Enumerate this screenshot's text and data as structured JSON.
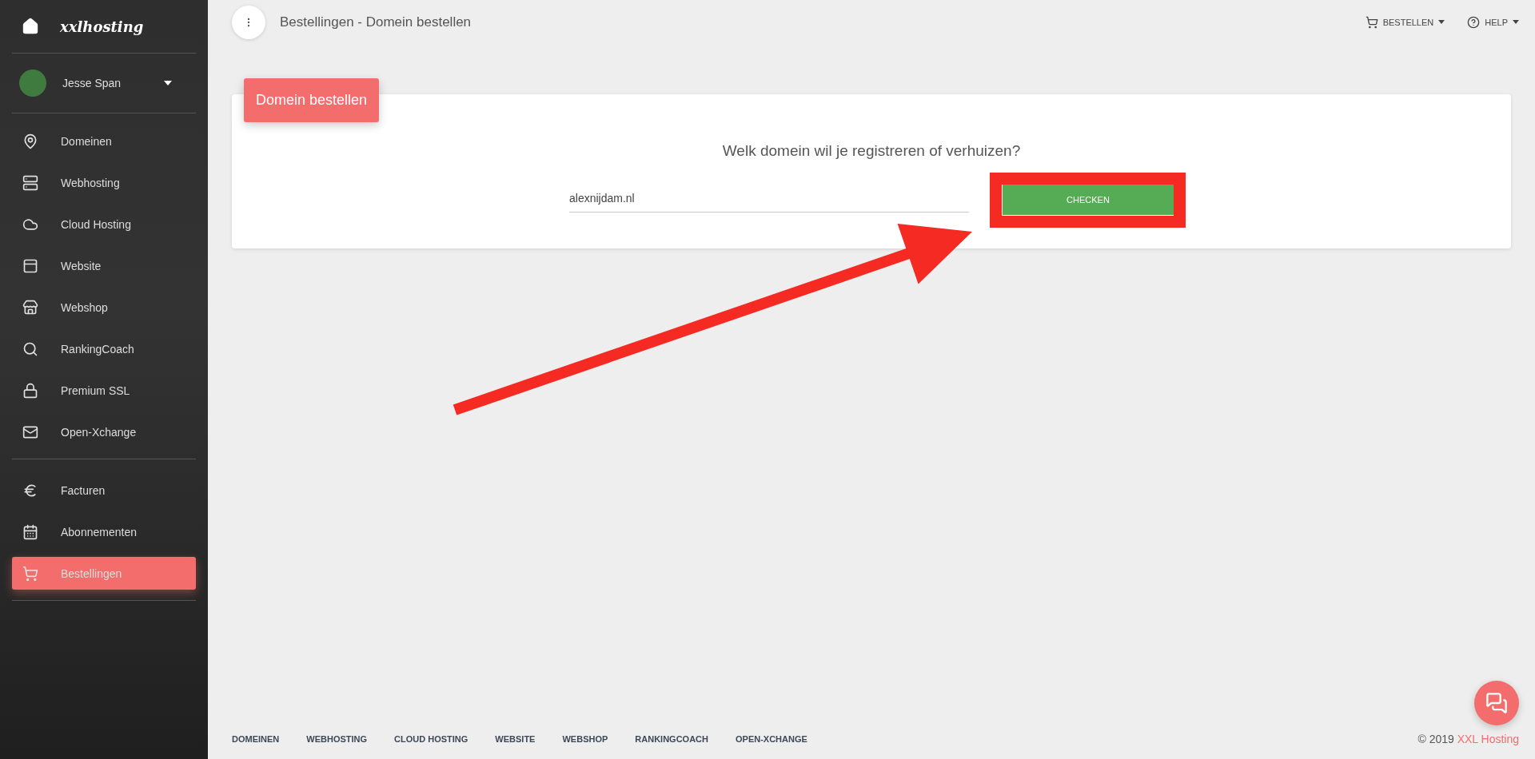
{
  "sidebar": {
    "brand": "xxlhosting",
    "user": {
      "name": "Jesse Span"
    },
    "sections": [
      [
        {
          "label": "Domeinen",
          "selected": false
        },
        {
          "label": "Webhosting",
          "selected": false
        },
        {
          "label": "Cloud Hosting",
          "selected": false
        },
        {
          "label": "Website",
          "selected": false
        },
        {
          "label": "Webshop",
          "selected": false
        },
        {
          "label": "RankingCoach",
          "selected": false
        },
        {
          "label": "Premium SSL",
          "selected": false
        },
        {
          "label": "Open-Xchange",
          "selected": false
        }
      ],
      [
        {
          "label": "Facturen",
          "selected": false
        },
        {
          "label": "Abonnementen",
          "selected": false
        },
        {
          "label": "Bestellingen",
          "selected": true
        }
      ]
    ]
  },
  "header": {
    "title": "Bestellingen - Domein bestellen",
    "actions": [
      {
        "label": "BESTELLEN"
      },
      {
        "label": "HELP"
      }
    ]
  },
  "card": {
    "tab": "Domein bestellen",
    "question": "Welk domein wil je registreren of verhuizen?",
    "domain_field": {
      "value": "alexnijdam.nl"
    },
    "button": "CHECKEN"
  },
  "footer": {
    "links": [
      "DOMEINEN",
      "WEBHOSTING",
      "CLOUD HOSTING",
      "WEBSITE",
      "WEBSHOP",
      "RANKINGCOACH",
      "OPEN-XCHANGE"
    ],
    "copyright": "© 2019",
    "copyright_link": "XXL Hosting"
  }
}
